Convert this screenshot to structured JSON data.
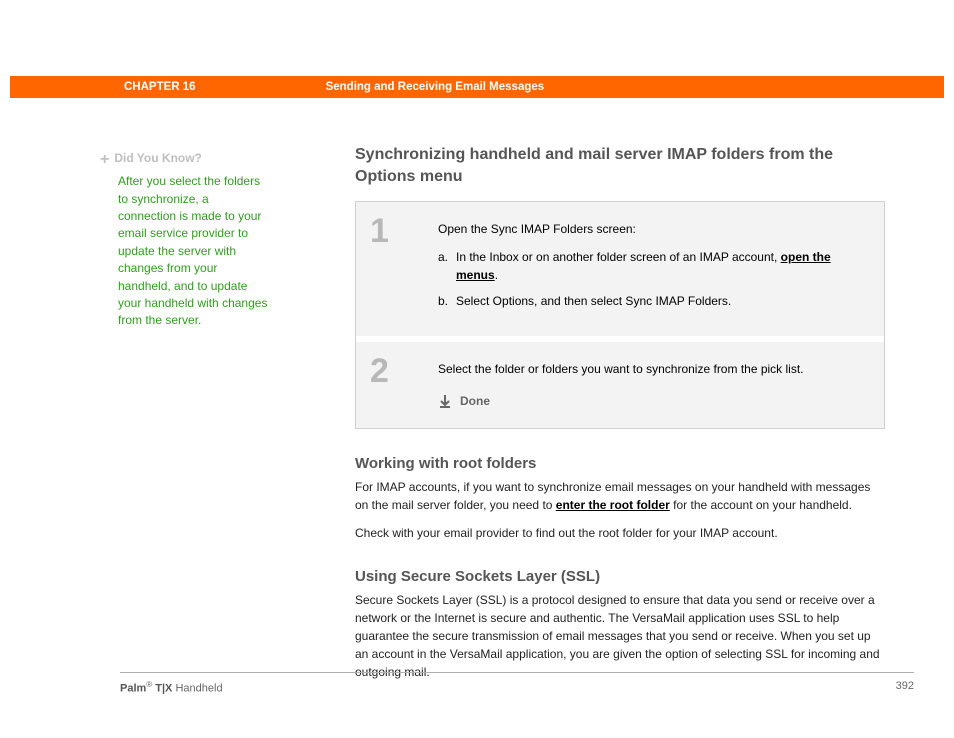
{
  "header": {
    "chapter": "CHAPTER 16",
    "title": "Sending and Receiving Email Messages"
  },
  "sidebar": {
    "dyk_label": "Did You Know?",
    "dyk_body": "After you select the folders to synchronize, a connection is made to your email service provider to update the server with changes from your handheld, and to update your handheld with changes from the server."
  },
  "main": {
    "title": "Synchronizing handheld and mail server IMAP folders from the Options menu",
    "steps": [
      {
        "num": "1",
        "lead": "Open the Sync IMAP Folders screen:",
        "sub": {
          "a_letter": "a.",
          "a_pre": "In the Inbox or on another folder screen of an IMAP account, ",
          "a_link": "open the menus",
          "a_post": ".",
          "b_letter": "b.",
          "b_text": "Select Options, and then select Sync IMAP Folders."
        }
      },
      {
        "num": "2",
        "lead": "Select the folder or folders you want to synchronize from the pick list.",
        "done": "Done"
      }
    ],
    "section2": {
      "heading": "Working with root folders",
      "p1_pre": "For IMAP accounts, if you want to synchronize email messages on your handheld with messages on the mail server folder, you need to ",
      "p1_link": "enter the root folder",
      "p1_post": " for the account on your handheld.",
      "p2": "Check with your email provider to find out the root folder for your IMAP account."
    },
    "section3": {
      "heading": "Using Secure Sockets Layer (SSL)",
      "p1": "Secure Sockets Layer (SSL) is a protocol designed to ensure that data you send or receive over a network or the Internet is secure and authentic. The VersaMail application uses SSL to help guarantee the secure transmission of email messages that you send or receive. When you set up an account in the VersaMail application, you are given the option of selecting SSL for incoming and outgoing mail."
    }
  },
  "footer": {
    "brand_bold": "Palm",
    "brand_reg": "®",
    "brand_model": " T|X",
    "brand_rest": " Handheld",
    "page": "392"
  }
}
